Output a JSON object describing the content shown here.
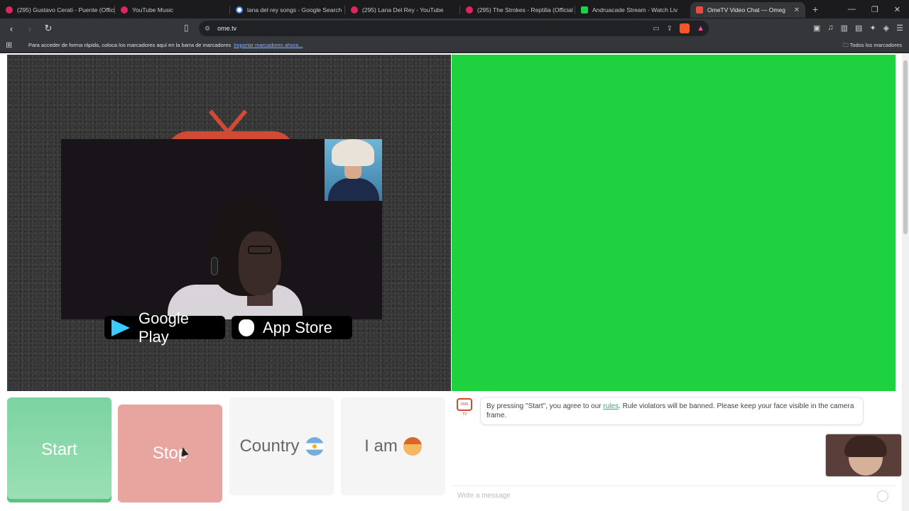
{
  "tabs": [
    {
      "title": "(295) Gustavo Cerati - Puente (Offici",
      "favicon": "youtube-icon"
    },
    {
      "title": "YouTube Music",
      "favicon": "youtube-music-icon"
    },
    {
      "title": "lana del rey songs - Google Search",
      "favicon": "google-icon"
    },
    {
      "title": "(295) Lana Del Rey - YouTube",
      "favicon": "youtube-icon"
    },
    {
      "title": "(295) The Strokes - Reptilia (Official",
      "favicon": "youtube-icon"
    },
    {
      "title": "Andruacade Stream - Watch Liv",
      "favicon": "kick-icon"
    },
    {
      "title": "OmeTV Video Chat — Omeg",
      "favicon": "ometv-icon",
      "active": true
    }
  ],
  "toolbar": {
    "url": "ome.tv"
  },
  "bookmarks_bar": {
    "hint": "Para acceder de forma rápida, coloca los marcadores aquí en la barra de marcadores",
    "import_link": "Importar marcadores ahora...",
    "all_bookmarks": "Todos los marcadores"
  },
  "page": {
    "store_buttons": {
      "google_play": "Google Play",
      "app_store": "App Store"
    },
    "controls": {
      "start": "Start",
      "stop": "Stop",
      "country": "Country",
      "i_am": "I am"
    },
    "chat": {
      "notice_before": "By pressing \"Start\", you agree to our ",
      "rules_link": "rules",
      "notice_after": ". Rule violators will be banned. Please keep your face visible in the camera frame.",
      "input_placeholder": "Write a message"
    },
    "colors": {
      "partner_video_bg": "#1ed13f",
      "start_button": "#7dd3a1",
      "stop_button": "#e8a5a0",
      "brand": "#d04a35"
    }
  }
}
